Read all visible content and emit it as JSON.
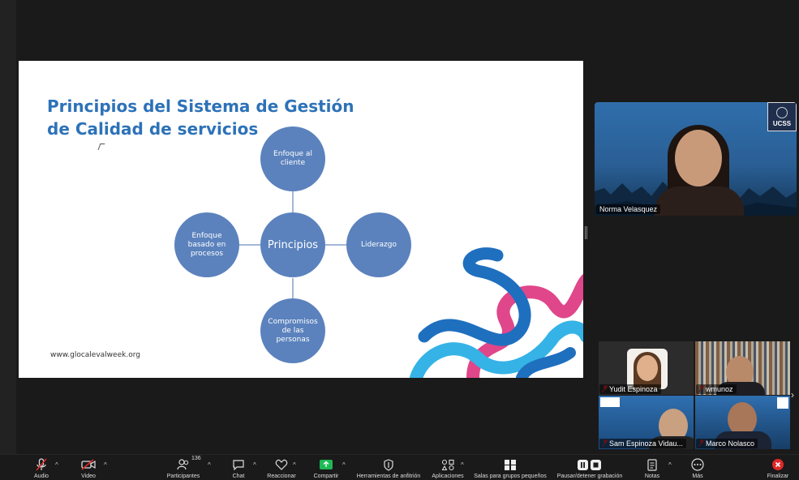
{
  "slide": {
    "title_line1": "Principios del Sistema de Gestión",
    "title_line2": "de Calidad de servicios",
    "website": "www.glocalevalweek.org",
    "diagram": {
      "center": "Principios",
      "top": [
        "Enfoque al",
        "cliente"
      ],
      "left": [
        "Enfoque",
        "basado en",
        "procesos"
      ],
      "right": [
        "Liderazgo"
      ],
      "bottom": [
        "Compromisos",
        "de las",
        "personas"
      ]
    },
    "colors": {
      "title": "#2d72b8",
      "node": "#5b82bd",
      "line": "#4a72ad"
    }
  },
  "speaker": {
    "name": "Norma Velasquez",
    "logo": "UCSS"
  },
  "gallery": [
    {
      "name": "Yudit Espinoza",
      "muted": true
    },
    {
      "name": "wmunoz",
      "muted": true
    },
    {
      "name": "Sam Espinoza Vidau...",
      "muted": true
    },
    {
      "name": "Marco Nolasco",
      "muted": true
    }
  ],
  "toolbar": {
    "audio": "Audio",
    "video": "Video",
    "participants": "Participantes",
    "participants_count": "136",
    "chat": "Chat",
    "reactions": "Reaccionar",
    "share": "Compartir",
    "host_tools": "Herramientas de anfitrión",
    "apps": "Aplicaciones",
    "breakout": "Salas para grupos pequeños",
    "record": "Pausar/detener grabación",
    "notes": "Notas",
    "more": "Más",
    "end": "Finalizar",
    "icons": [
      "mic-off-icon",
      "video-off-icon",
      "participants-icon",
      "chat-icon",
      "heart-icon",
      "share-arrow-icon",
      "shield-icon",
      "apps-icon",
      "grid-icon",
      "pause-stop-icon",
      "notes-icon",
      "more-icon",
      "close-icon"
    ]
  }
}
